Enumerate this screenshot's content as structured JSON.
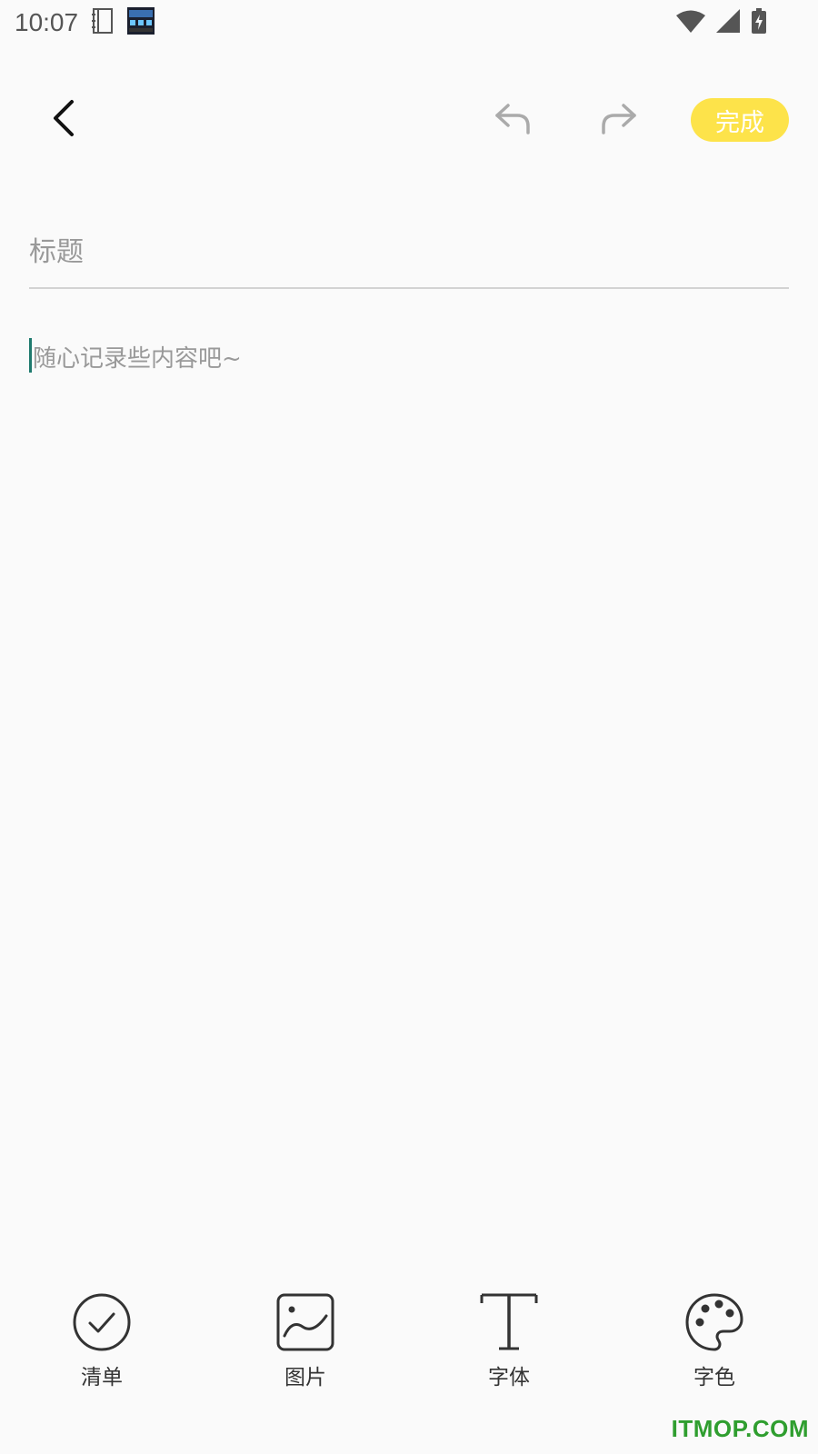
{
  "status_bar": {
    "time": "10:07",
    "icons": [
      "notebook-icon",
      "clock-widget-icon",
      "wifi-icon",
      "cell-signal-icon",
      "battery-charging-icon"
    ]
  },
  "toolbar": {
    "back_icon": "chevron-left-icon",
    "undo_icon": "undo-icon",
    "redo_icon": "redo-icon",
    "done_label": "完成"
  },
  "editor": {
    "title_placeholder": "标题",
    "title_value": "",
    "content_placeholder": "随心记录些内容吧~",
    "content_value": ""
  },
  "bottom_tools": [
    {
      "label": "清单",
      "icon": "checklist-icon"
    },
    {
      "label": "图片",
      "icon": "image-icon"
    },
    {
      "label": "字体",
      "icon": "font-icon"
    },
    {
      "label": "字色",
      "icon": "palette-icon"
    }
  ],
  "colors": {
    "accent": "#fde34a",
    "background": "#fafafa",
    "caret": "#1f7a6e",
    "watermark": "#2f9e2f"
  },
  "watermark": "ITMOP.COM"
}
